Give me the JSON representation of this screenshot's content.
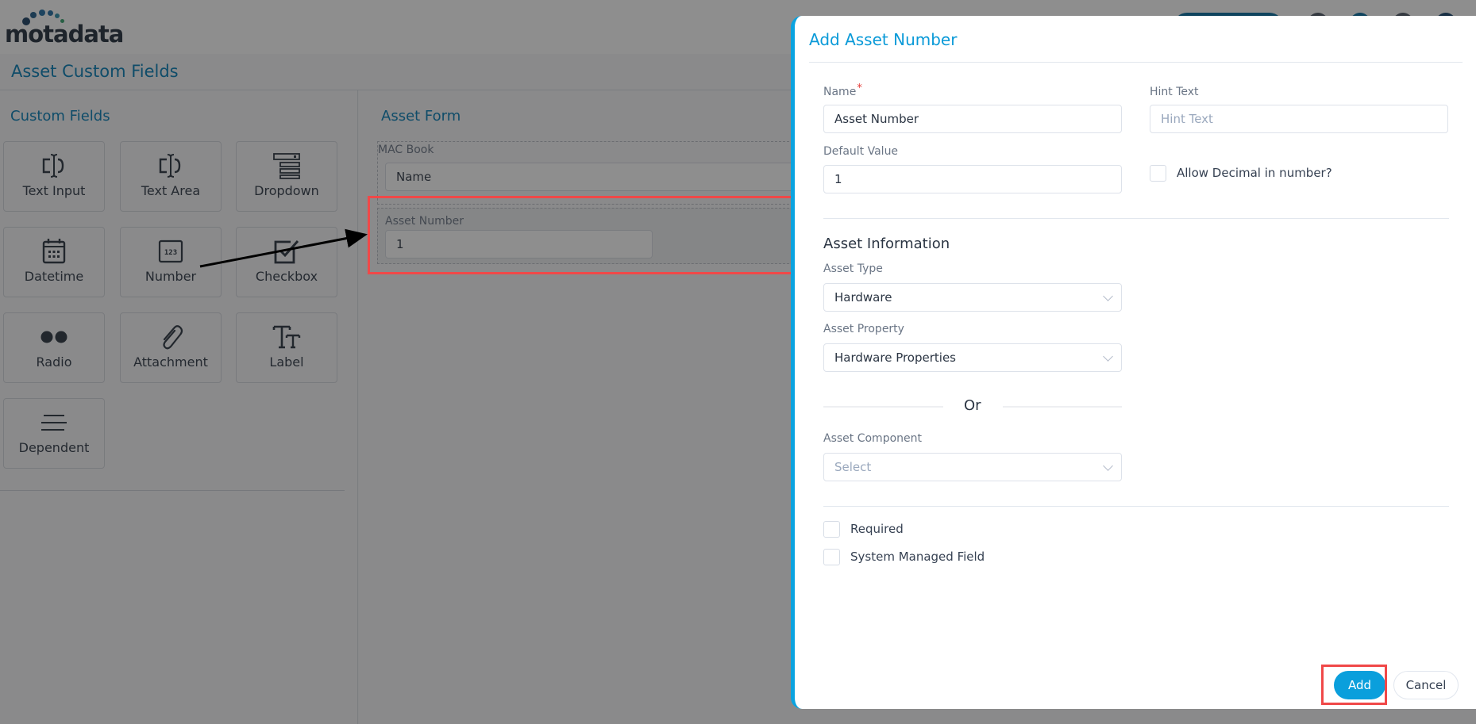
{
  "app": {
    "brand": "motadata",
    "page_title": "Asset Custom Fields"
  },
  "custom_fields": {
    "title": "Custom Fields",
    "tiles": [
      {
        "label": "Text Input",
        "icon": "text-input-icon"
      },
      {
        "label": "Text Area",
        "icon": "text-area-icon"
      },
      {
        "label": "Dropdown",
        "icon": "dropdown-icon"
      },
      {
        "label": "Datetime",
        "icon": "calendar-icon"
      },
      {
        "label": "Number",
        "icon": "number-123-icon"
      },
      {
        "label": "Checkbox",
        "icon": "checkbox-icon"
      },
      {
        "label": "Radio",
        "icon": "radio-icon"
      },
      {
        "label": "Attachment",
        "icon": "paperclip-icon"
      },
      {
        "label": "Label",
        "icon": "text-size-icon"
      },
      {
        "label": "Dependent",
        "icon": "lines-icon"
      }
    ]
  },
  "asset_form": {
    "title": "Asset Form",
    "group_label": "MAC Book",
    "name_field_value": "Name",
    "new_field_label": "Asset Number",
    "new_field_value": "1"
  },
  "drawer": {
    "title": "Add Asset Number",
    "name_label": "Name",
    "name_required_mark": "*",
    "name_value": "Asset Number",
    "hint_label": "Hint Text",
    "hint_placeholder": "Hint Text",
    "default_label": "Default Value",
    "default_value": "1",
    "allow_decimal_label": "Allow Decimal in number?",
    "allow_decimal_checked": false,
    "asset_info_title": "Asset Information",
    "asset_type_label": "Asset Type",
    "asset_type_value": "Hardware",
    "asset_property_label": "Asset Property",
    "asset_property_value": "Hardware Properties",
    "or_text": "Or",
    "asset_component_label": "Asset Component",
    "asset_component_placeholder": "Select",
    "required_label": "Required",
    "required_checked": false,
    "system_managed_label": "System Managed Field",
    "system_managed_checked": false,
    "add_button": "Add",
    "cancel_button": "Cancel"
  },
  "colors": {
    "accent": "#0a9fdc",
    "title_blue": "#007bb5",
    "annotation_red": "#f04848",
    "overlay": "#8c8c8c"
  }
}
